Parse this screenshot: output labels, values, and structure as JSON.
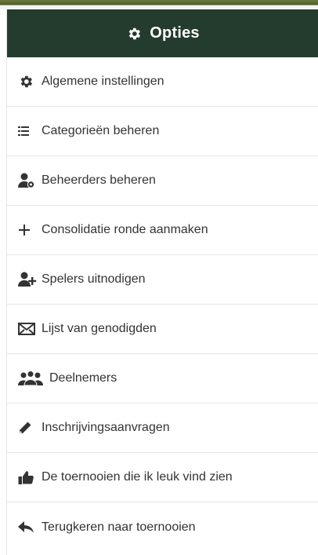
{
  "header": {
    "title": "Opties",
    "icon": "gear-icon"
  },
  "menu": {
    "items": [
      {
        "label": "Algemene instellingen",
        "icon": "gear-icon"
      },
      {
        "label": "Categorieën beheren",
        "icon": "list-icon"
      },
      {
        "label": "Beheerders beheren",
        "icon": "user-gear-icon"
      },
      {
        "label": "Consolidatie ronde aanmaken",
        "icon": "plus-icon"
      },
      {
        "label": "Spelers uitnodigen",
        "icon": "user-plus-icon"
      },
      {
        "label": "Lijst van genodigden",
        "icon": "envelope-icon"
      },
      {
        "label": "Deelnemers",
        "icon": "users-icon"
      },
      {
        "label": "Inschrijvingsaanvragen",
        "icon": "pencil-icon"
      },
      {
        "label": "De toernooien die ik leuk vind zien",
        "icon": "thumbs-up-icon"
      },
      {
        "label": "Terugkeren naar toernooien",
        "icon": "reply-icon"
      }
    ]
  },
  "colors": {
    "header_bg": "#243c2d",
    "text": "#333333",
    "divider": "#e6e6e6"
  }
}
